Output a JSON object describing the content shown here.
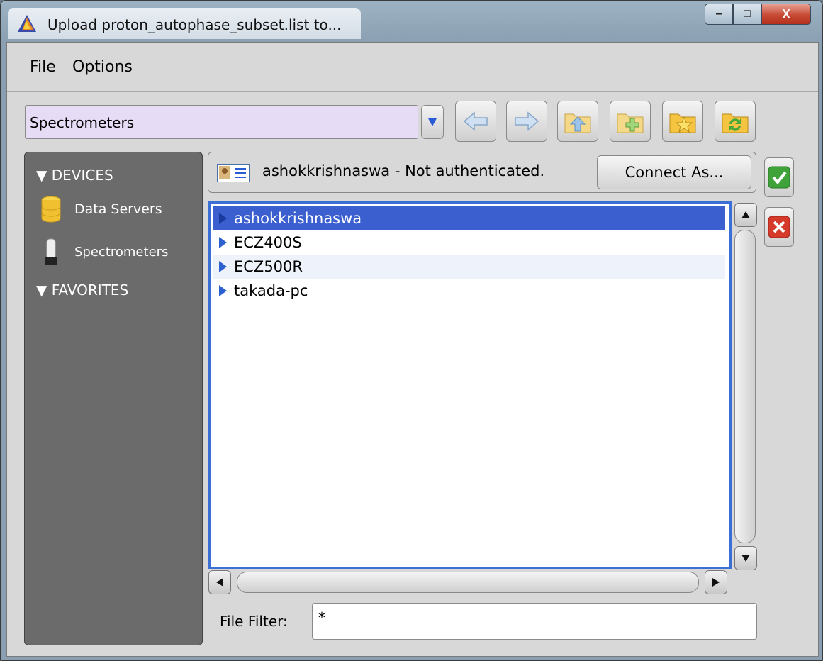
{
  "window": {
    "title": "Upload proton_autophase_subset.list to...",
    "controls": {
      "minimize": "–",
      "maximize": "□",
      "close": "X"
    }
  },
  "menu": {
    "items": [
      "File",
      "Options"
    ]
  },
  "location": {
    "value": "Spectrometers"
  },
  "toolbar": {
    "icons": [
      "dropdown-icon",
      "back-arrow-icon",
      "forward-arrow-icon",
      "folder-up-icon",
      "new-folder-icon",
      "favorite-folder-icon",
      "refresh-folder-icon"
    ]
  },
  "sidebar": {
    "devices_header": "DEVICES",
    "items": [
      {
        "label": "Data Servers",
        "icon": "database-icon"
      },
      {
        "label": "Spectrometers",
        "icon": "spectrometer-icon"
      }
    ],
    "favorites_header": "FAVORITES"
  },
  "user": {
    "status": "ashokkrishnaswa - Not authenticated.",
    "connect_label": "Connect As..."
  },
  "files": {
    "rows": [
      {
        "name": "ashokkrishnaswa",
        "selected": true
      },
      {
        "name": "ECZ400S",
        "selected": false
      },
      {
        "name": "ECZ500R",
        "selected": false
      },
      {
        "name": "takada-pc",
        "selected": false
      }
    ]
  },
  "filter": {
    "label": "File Filter:",
    "value": "*"
  },
  "colors": {
    "selection": "#3b5fcf",
    "sidebar": "#6b6b6b",
    "combo": "#e7dcf6",
    "ok": "#3fa33a",
    "cancel": "#d63a2a"
  }
}
